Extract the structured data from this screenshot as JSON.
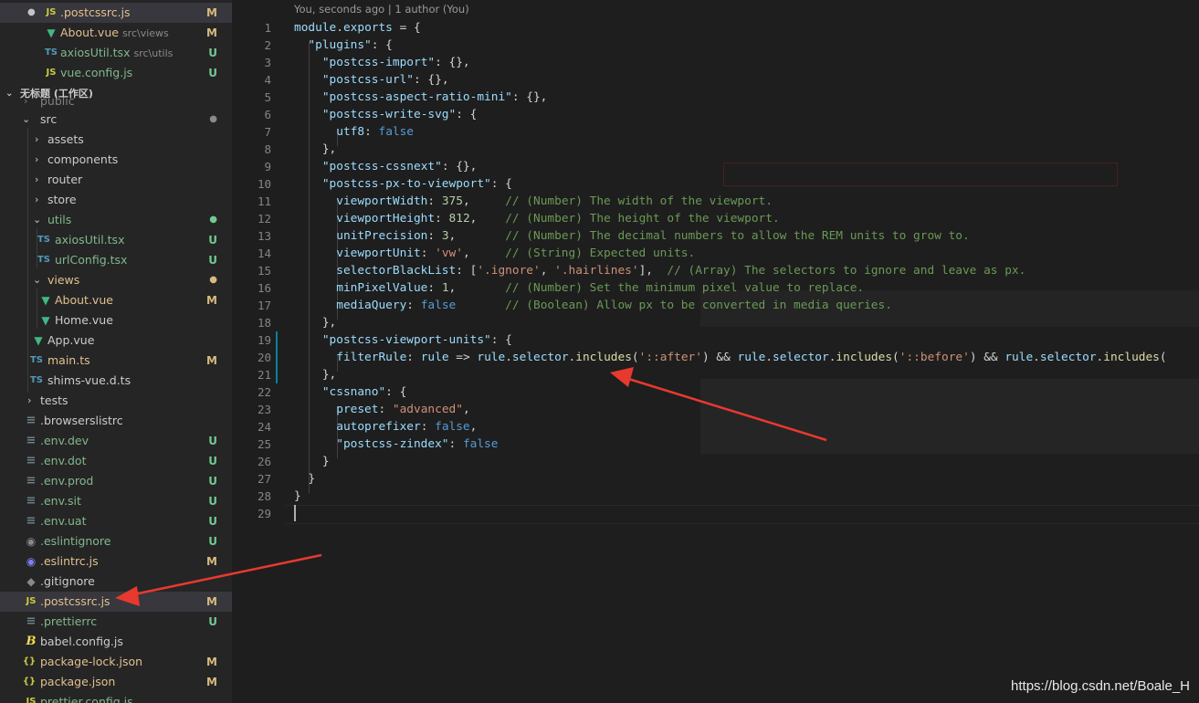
{
  "sidebar": {
    "workspace_title": "无标题 (工作区)",
    "items": [
      {
        "label": ".postcssrc.js",
        "icon": "js-file-icon",
        "badge": "M",
        "state": "mod",
        "selected": true
      },
      {
        "label": "About.vue",
        "desc": "src\\views",
        "icon": "vue-file-icon",
        "badge": "M",
        "state": "mod"
      },
      {
        "label": "axiosUtil.tsx",
        "desc": "src\\utils",
        "icon": "ts-file-icon",
        "badge": "U",
        "state": "new"
      },
      {
        "label": "vue.config.js",
        "icon": "js-file-icon",
        "badge": "U",
        "state": "new"
      },
      {
        "label": "public",
        "icon": "folder",
        "state": "plain"
      },
      {
        "label": "src",
        "icon": "folder-open",
        "badge": "●",
        "state": "plain"
      },
      {
        "label": "assets",
        "icon": "folder",
        "state": "plain"
      },
      {
        "label": "components",
        "icon": "folder",
        "state": "plain"
      },
      {
        "label": "router",
        "icon": "folder",
        "state": "plain"
      },
      {
        "label": "store",
        "icon": "folder",
        "state": "plain"
      },
      {
        "label": "utils",
        "icon": "folder-open",
        "badge": "●",
        "state": "new"
      },
      {
        "label": "axiosUtil.tsx",
        "icon": "ts-file-icon",
        "badge": "U",
        "state": "new"
      },
      {
        "label": "urlConfig.tsx",
        "icon": "ts-file-icon",
        "badge": "U",
        "state": "new"
      },
      {
        "label": "views",
        "icon": "folder-open",
        "badge": "●",
        "state": "mod"
      },
      {
        "label": "About.vue",
        "icon": "vue-file-icon",
        "badge": "M",
        "state": "mod"
      },
      {
        "label": "Home.vue",
        "icon": "vue-file-icon",
        "state": "plain"
      },
      {
        "label": "App.vue",
        "icon": "vue-file-icon",
        "state": "plain"
      },
      {
        "label": "main.ts",
        "icon": "ts-file-icon",
        "badge": "M",
        "state": "mod"
      },
      {
        "label": "shims-vue.d.ts",
        "icon": "ts-file-icon",
        "state": "plain"
      },
      {
        "label": "tests",
        "icon": "folder",
        "state": "plain"
      },
      {
        "label": ".browserslistrc",
        "icon": "lines-icon",
        "state": "plain"
      },
      {
        "label": ".env.dev",
        "icon": "lines-icon",
        "badge": "U",
        "state": "new"
      },
      {
        "label": ".env.dot",
        "icon": "lines-icon",
        "badge": "U",
        "state": "new"
      },
      {
        "label": ".env.prod",
        "icon": "lines-icon",
        "badge": "U",
        "state": "new"
      },
      {
        "label": ".env.sit",
        "icon": "lines-icon",
        "badge": "U",
        "state": "new"
      },
      {
        "label": ".env.uat",
        "icon": "lines-icon",
        "badge": "U",
        "state": "new"
      },
      {
        "label": ".eslintignore",
        "icon": "eslint-icon",
        "badge": "U",
        "state": "new"
      },
      {
        "label": ".eslintrc.js",
        "icon": "eslint-icon",
        "badge": "M",
        "state": "mod"
      },
      {
        "label": ".gitignore",
        "icon": "git-icon",
        "state": "plain"
      },
      {
        "label": ".postcssrc.js",
        "icon": "js-file-icon",
        "badge": "M",
        "state": "mod",
        "selected": true
      },
      {
        "label": ".prettierrc",
        "icon": "lines-icon",
        "badge": "U",
        "state": "new"
      },
      {
        "label": "babel.config.js",
        "icon": "babel-icon",
        "state": "plain"
      },
      {
        "label": "package-lock.json",
        "icon": "json-icon",
        "badge": "M",
        "state": "mod"
      },
      {
        "label": "package.json",
        "icon": "json-icon",
        "badge": "M",
        "state": "mod"
      },
      {
        "label": "prettier.config.js",
        "icon": "js-file-icon",
        "state": "new"
      }
    ]
  },
  "editor": {
    "blame": "You, seconds ago | 1 author (You)",
    "line_numbers": [
      "1",
      "2",
      "3",
      "4",
      "5",
      "6",
      "7",
      "8",
      "9",
      "10",
      "11",
      "12",
      "13",
      "14",
      "15",
      "16",
      "17",
      "18",
      "19",
      "20",
      "21",
      "22",
      "23",
      "24",
      "25",
      "26",
      "27",
      "28",
      "29"
    ],
    "lines": [
      "module.exports = {",
      "  \"plugins\": {",
      "    \"postcss-import\": {},",
      "    \"postcss-url\": {},",
      "    \"postcss-aspect-ratio-mini\": {},",
      "    \"postcss-write-svg\": {",
      "      utf8: false",
      "    },",
      "    \"postcss-cssnext\": {},",
      "    \"postcss-px-to-viewport\": {",
      "      viewportWidth: 375,     // (Number) The width of the viewport.",
      "      viewportHeight: 812,    // (Number) The height of the viewport.",
      "      unitPrecision: 3,       // (Number) The decimal numbers to allow the REM units to grow to.",
      "      viewportUnit: 'vw',     // (String) Expected units.",
      "      selectorBlackList: ['.ignore', '.hairlines'],  // (Array) The selectors to ignore and leave as px.",
      "      minPixelValue: 1,       // (Number) Set the minimum pixel value to replace.",
      "      mediaQuery: false       // (Boolean) Allow px to be converted in media queries.",
      "    },",
      "    \"postcss-viewport-units\": {",
      "      filterRule: rule => rule.selector.includes('::after') && rule.selector.includes('::before') && rule.selector.includes('",
      "    },",
      "    \"cssnano\": {",
      "      preset: \"advanced\",",
      "      autoprefixer: false,",
      "      \"postcss-zindex\": false",
      "    }",
      "  }",
      "}",
      ""
    ]
  },
  "watermark": "https://blog.csdn.net/Boale_H",
  "colors": {
    "sidebar_bg": "#252526",
    "editor_bg": "#1e1e1e",
    "modified": "#e2c08d",
    "untracked": "#81b88b",
    "arrow": "#e8392f"
  }
}
